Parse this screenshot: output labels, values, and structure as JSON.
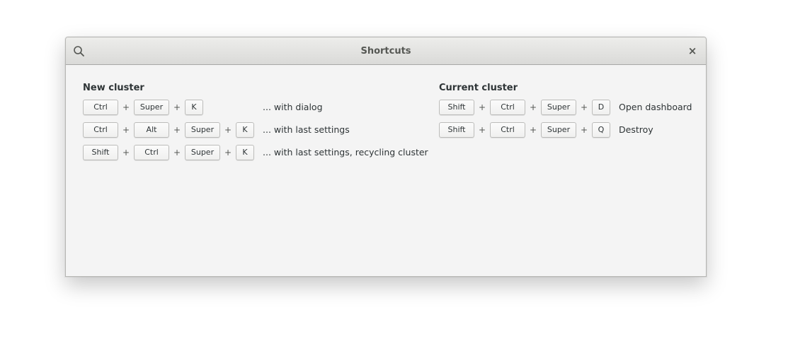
{
  "window": {
    "title": "Shortcuts"
  },
  "titlebar": {
    "search_icon": "search-icon",
    "close_label": "×"
  },
  "sections": {
    "new_cluster": {
      "title": "New cluster",
      "rows": [
        {
          "keys": [
            "Ctrl",
            "Super",
            "K"
          ],
          "plus": [
            "+",
            "+"
          ],
          "desc": "... with dialog"
        },
        {
          "keys": [
            "Ctrl",
            "Alt",
            "Super",
            "K"
          ],
          "plus": [
            "+",
            "+",
            "+"
          ],
          "desc": "... with last settings"
        },
        {
          "keys": [
            "Shift",
            "Ctrl",
            "Super",
            "K"
          ],
          "plus": [
            "+",
            "+",
            "+"
          ],
          "desc": "... with last settings, recycling cluster"
        }
      ]
    },
    "current_cluster": {
      "title": "Current cluster",
      "rows": [
        {
          "keys": [
            "Shift",
            "Ctrl",
            "Super",
            "D"
          ],
          "plus": [
            "+",
            "+",
            "+"
          ],
          "desc": "Open dashboard"
        },
        {
          "keys": [
            "Shift",
            "Ctrl",
            "Super",
            "Q"
          ],
          "plus": [
            "+",
            "+",
            "+"
          ],
          "desc": "Destroy"
        }
      ]
    }
  }
}
